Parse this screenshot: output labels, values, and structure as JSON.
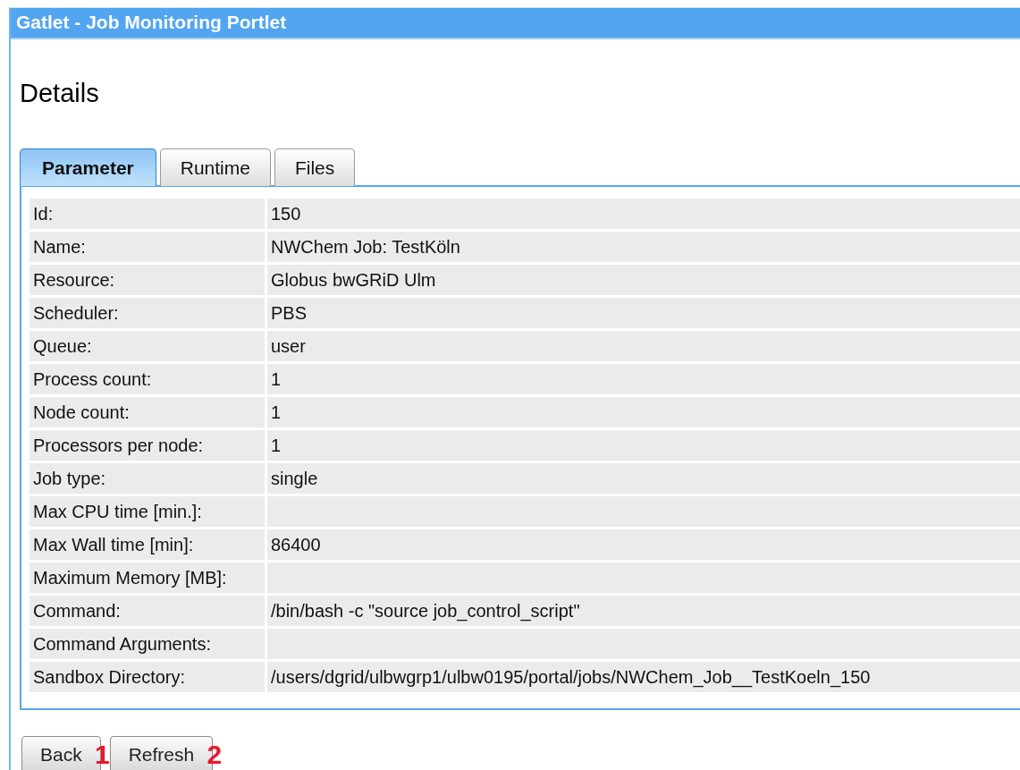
{
  "portlet": {
    "title": "Gatlet - Job Monitoring Portlet"
  },
  "heading": "Details",
  "tabs": [
    {
      "label": "Parameter",
      "selected": true
    },
    {
      "label": "Runtime",
      "selected": false
    },
    {
      "label": "Files",
      "selected": false
    }
  ],
  "rows": [
    {
      "label": "Id:",
      "value": "150"
    },
    {
      "label": "Name:",
      "value": "NWChem Job: TestKöln"
    },
    {
      "label": "Resource:",
      "value": "Globus bwGRiD Ulm"
    },
    {
      "label": "Scheduler:",
      "value": "PBS"
    },
    {
      "label": "Queue:",
      "value": "user"
    },
    {
      "label": "Process count:",
      "value": "1"
    },
    {
      "label": "Node count:",
      "value": "1"
    },
    {
      "label": "Processors per node:",
      "value": "1"
    },
    {
      "label": "Job type:",
      "value": "single"
    },
    {
      "label": "Max CPU time [min.]:",
      "value": ""
    },
    {
      "label": "Max Wall time [min]:",
      "value": "86400"
    },
    {
      "label": "Maximum Memory [MB]:",
      "value": ""
    },
    {
      "label": "Command:",
      "value": "/bin/bash -c \"source job_control_script\""
    },
    {
      "label": "Command Arguments:",
      "value": ""
    },
    {
      "label": "Sandbox Directory:",
      "value": "/users/dgrid/ulbwgrp1/ulbw0195/portal/jobs/NWChem_Job__TestKoeln_150"
    }
  ],
  "buttons": [
    {
      "label": "Back",
      "marker": "1"
    },
    {
      "label": "Refresh",
      "marker": "2"
    }
  ]
}
